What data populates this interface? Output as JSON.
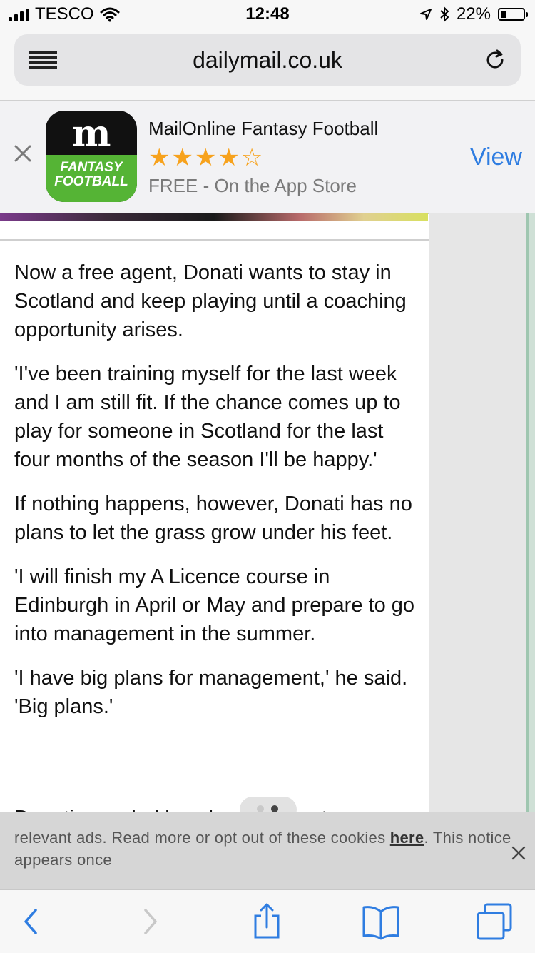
{
  "status_bar": {
    "carrier": "TESCO",
    "time": "12:48",
    "battery": "22%",
    "battery_level": 0.22
  },
  "url_bar": {
    "url": "dailymail.co.uk"
  },
  "app_banner": {
    "icon_text": "FANTASY FOOTBALL",
    "title": "MailOnline Fantasy Football",
    "rating_stars": "★★★★☆",
    "rating": 4.5,
    "subtitle": "FREE - On the App Store",
    "view_label": "View"
  },
  "article": {
    "paragraphs": [
      "Now a free agent, Donati wants to stay in Scotland and keep playing until a coaching opportunity arises.",
      "'I've been training myself for the last week and I am still fit. If the chance comes up to play for someone in Scotland for the last four months of the season I'll be happy.'",
      "If nothing happens, however, Donati has no plans to let the grass grow under his feet.",
      "'I will finish my A Licence course in Edinburgh in April or May and prepare to go into management in the summer.",
      "'I have big plans for management,' he said. 'Big plans.'"
    ],
    "cut_text": "Donati revealed how he... podcast"
  },
  "cookie_notice": {
    "text_before": "relevant ads. Read more or opt out of these cookies ",
    "link": "here",
    "text_after": ". This notice appears once"
  },
  "colors": {
    "link_blue": "#2f7de1",
    "star_orange": "#f7a21c",
    "app_green": "#55b435"
  }
}
